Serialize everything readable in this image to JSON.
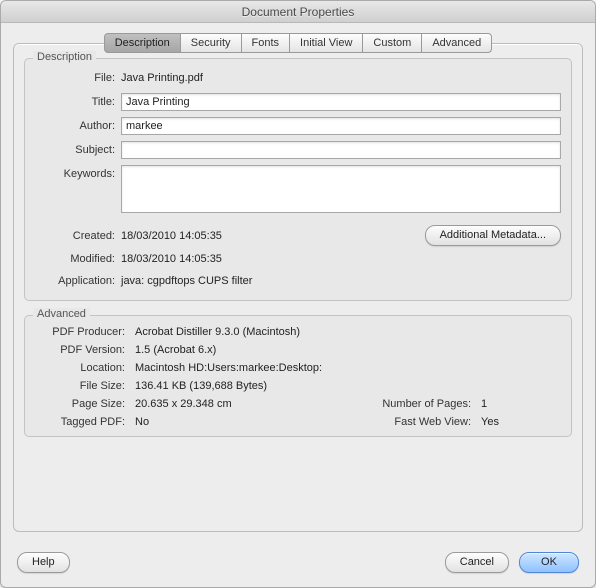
{
  "window": {
    "title": "Document Properties"
  },
  "tabs": {
    "description": "Description",
    "security": "Security",
    "fonts": "Fonts",
    "initial_view": "Initial View",
    "custom": "Custom",
    "advanced": "Advanced"
  },
  "description_group": {
    "title": "Description",
    "file_label": "File:",
    "file_value": "Java Printing.pdf",
    "title_label": "Title:",
    "title_value": "Java Printing",
    "author_label": "Author:",
    "author_value": "markee",
    "subject_label": "Subject:",
    "subject_value": "",
    "keywords_label": "Keywords:",
    "keywords_value": "",
    "created_label": "Created:",
    "created_value": "18/03/2010 14:05:35",
    "modified_label": "Modified:",
    "modified_value": "18/03/2010 14:05:35",
    "application_label": "Application:",
    "application_value": "java: cgpdftops CUPS filter",
    "additional_metadata_button": "Additional Metadata..."
  },
  "advanced_group": {
    "title": "Advanced",
    "producer_label": "PDF Producer:",
    "producer_value": "Acrobat Distiller 9.3.0 (Macintosh)",
    "version_label": "PDF Version:",
    "version_value": "1.5 (Acrobat 6.x)",
    "location_label": "Location:",
    "location_value": "Macintosh HD:Users:markee:Desktop:",
    "filesize_label": "File Size:",
    "filesize_value": "136.41 KB (139,688 Bytes)",
    "pagesize_label": "Page Size:",
    "pagesize_value": "20.635 x 29.348 cm",
    "numpages_label": "Number of Pages:",
    "numpages_value": "1",
    "tagged_label": "Tagged PDF:",
    "tagged_value": "No",
    "fastweb_label": "Fast Web View:",
    "fastweb_value": "Yes"
  },
  "footer": {
    "help": "Help",
    "cancel": "Cancel",
    "ok": "OK"
  }
}
